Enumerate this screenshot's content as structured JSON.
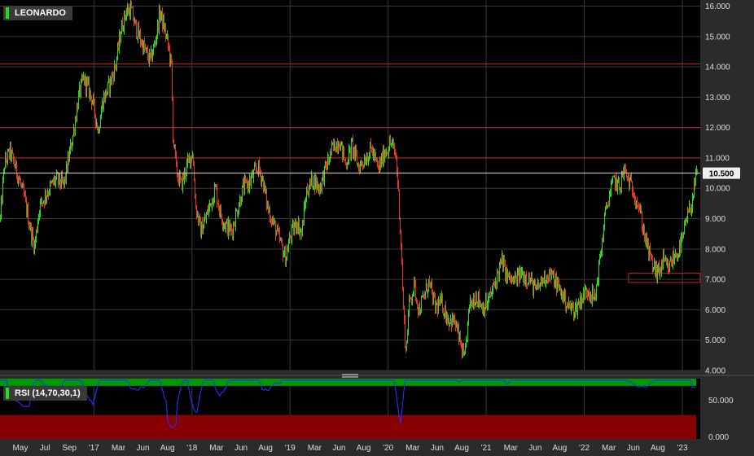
{
  "colors": {
    "background": "#000000",
    "frame": "#2b2b2b",
    "up": "#22dd22",
    "down": "#ee3322",
    "level_line": "#cc2222",
    "price_line": "#dddddd",
    "rsi_line": "#2233ff",
    "rsi_upper_zone": "#009900",
    "rsi_lower_zone": "#880000",
    "axis_text": "#dddddd",
    "grid": "#3a3a3a"
  },
  "chart_data": [
    {
      "type": "candlestick",
      "title": "LEONARDO",
      "ylim": [
        4.0,
        16.2
      ],
      "yticks": [
        "4.000",
        "5.000",
        "6.000",
        "7.000",
        "8.000",
        "9.000",
        "10.000",
        "11.000",
        "12.000",
        "13.000",
        "14.000",
        "15.000",
        "16.000"
      ],
      "ytick_values": [
        4,
        5,
        6,
        7,
        8,
        9,
        10,
        11,
        12,
        13,
        14,
        15,
        16
      ],
      "xlabels": [
        "May",
        "Jul",
        "Sep",
        "'17",
        "Mar",
        "Jun",
        "Aug",
        "'18",
        "Mar",
        "Jun",
        "Aug",
        "'19",
        "Mar",
        "Jun",
        "Aug",
        "'20",
        "Mar",
        "Jun",
        "Aug",
        "'21",
        "Mar",
        "Jun",
        "Aug",
        "'22",
        "Mar",
        "Jun",
        "Aug",
        "'23"
      ],
      "last_price": "10.500",
      "last_value": 10.5,
      "horizontal_levels": [
        14.1,
        12.0,
        11.0
      ],
      "zone": {
        "from": 6.9,
        "to": 7.2,
        "x_start": "Aug '22",
        "x_end": "'23"
      },
      "path": [
        [
          0,
          9.0
        ],
        [
          5,
          10.8
        ],
        [
          12,
          11.2
        ],
        [
          22,
          10.4
        ],
        [
          30,
          9.6
        ],
        [
          38,
          8.5
        ],
        [
          42,
          8.1
        ],
        [
          48,
          9.4
        ],
        [
          58,
          9.9
        ],
        [
          68,
          10.3
        ],
        [
          78,
          10.1
        ],
        [
          84,
          11.0
        ],
        [
          90,
          11.9
        ],
        [
          96,
          13.0
        ],
        [
          102,
          13.6
        ],
        [
          108,
          13.3
        ],
        [
          114,
          12.8
        ],
        [
          120,
          11.9
        ],
        [
          126,
          12.9
        ],
        [
          134,
          13.4
        ],
        [
          142,
          14.1
        ],
        [
          148,
          15.2
        ],
        [
          154,
          15.8
        ],
        [
          160,
          15.9
        ],
        [
          166,
          15.3
        ],
        [
          172,
          14.9
        ],
        [
          178,
          14.5
        ],
        [
          184,
          14.2
        ],
        [
          190,
          14.8
        ],
        [
          196,
          15.8
        ],
        [
          202,
          15.2
        ],
        [
          206,
          14.7
        ],
        [
          210,
          14.0
        ],
        [
          212,
          11.8
        ],
        [
          216,
          10.6
        ],
        [
          222,
          10.1
        ],
        [
          230,
          10.8
        ],
        [
          236,
          11.2
        ],
        [
          240,
          9.4
        ],
        [
          246,
          8.6
        ],
        [
          252,
          9.0
        ],
        [
          258,
          9.5
        ],
        [
          264,
          10.0
        ],
        [
          270,
          9.2
        ],
        [
          276,
          8.8
        ],
        [
          284,
          8.6
        ],
        [
          292,
          9.4
        ],
        [
          298,
          10.0
        ],
        [
          306,
          10.2
        ],
        [
          316,
          10.7
        ],
        [
          322,
          10.3
        ],
        [
          328,
          9.4
        ],
        [
          336,
          8.8
        ],
        [
          344,
          8.2
        ],
        [
          350,
          7.7
        ],
        [
          356,
          8.4
        ],
        [
          364,
          8.9
        ],
        [
          370,
          8.5
        ],
        [
          376,
          9.9
        ],
        [
          384,
          10.3
        ],
        [
          392,
          10.0
        ],
        [
          400,
          10.7
        ],
        [
          408,
          11.3
        ],
        [
          416,
          11.6
        ],
        [
          424,
          10.8
        ],
        [
          432,
          11.4
        ],
        [
          440,
          10.7
        ],
        [
          448,
          11.0
        ],
        [
          456,
          11.3
        ],
        [
          464,
          10.6
        ],
        [
          472,
          11.2
        ],
        [
          480,
          11.5
        ],
        [
          486,
          11.0
        ],
        [
          489,
          9.8
        ],
        [
          492,
          8.2
        ],
        [
          495,
          6.0
        ],
        [
          498,
          4.6
        ],
        [
          502,
          6.2
        ],
        [
          508,
          6.8
        ],
        [
          514,
          6.0
        ],
        [
          520,
          6.4
        ],
        [
          526,
          6.9
        ],
        [
          534,
          6.1
        ],
        [
          542,
          6.2
        ],
        [
          550,
          5.7
        ],
        [
          558,
          5.6
        ],
        [
          564,
          5.0
        ],
        [
          570,
          4.3
        ],
        [
          576,
          6.1
        ],
        [
          584,
          6.5
        ],
        [
          592,
          6.1
        ],
        [
          598,
          6.2
        ],
        [
          604,
          6.6
        ],
        [
          610,
          7.1
        ],
        [
          616,
          7.6
        ],
        [
          622,
          7.1
        ],
        [
          630,
          6.9
        ],
        [
          640,
          7.2
        ],
        [
          650,
          7.0
        ],
        [
          658,
          6.6
        ],
        [
          666,
          7.0
        ],
        [
          674,
          7.2
        ],
        [
          682,
          6.9
        ],
        [
          690,
          6.5
        ],
        [
          698,
          6.1
        ],
        [
          706,
          6.0
        ],
        [
          714,
          6.4
        ],
        [
          722,
          6.7
        ],
        [
          730,
          6.3
        ],
        [
          734,
          7.2
        ],
        [
          738,
          8.0
        ],
        [
          742,
          9.0
        ],
        [
          748,
          9.8
        ],
        [
          754,
          10.3
        ],
        [
          760,
          10.0
        ],
        [
          766,
          10.6
        ],
        [
          772,
          10.2
        ],
        [
          778,
          9.9
        ],
        [
          784,
          9.4
        ],
        [
          790,
          8.6
        ],
        [
          796,
          7.9
        ],
        [
          802,
          7.4
        ],
        [
          808,
          7.2
        ],
        [
          814,
          7.6
        ],
        [
          820,
          7.3
        ],
        [
          826,
          7.7
        ],
        [
          832,
          7.9
        ],
        [
          838,
          8.3
        ],
        [
          842,
          8.9
        ],
        [
          848,
          9.4
        ],
        [
          852,
          10.0
        ],
        [
          856,
          10.5
        ]
      ]
    },
    {
      "type": "line",
      "title": "RSI (14,70,30,1)",
      "ylim": [
        -3,
        80
      ],
      "yticks": [
        "50.000",
        "0.000"
      ],
      "ytick_values": [
        50,
        0
      ],
      "upper_band": 70,
      "lower_band": 30,
      "last_value": 68
    }
  ]
}
